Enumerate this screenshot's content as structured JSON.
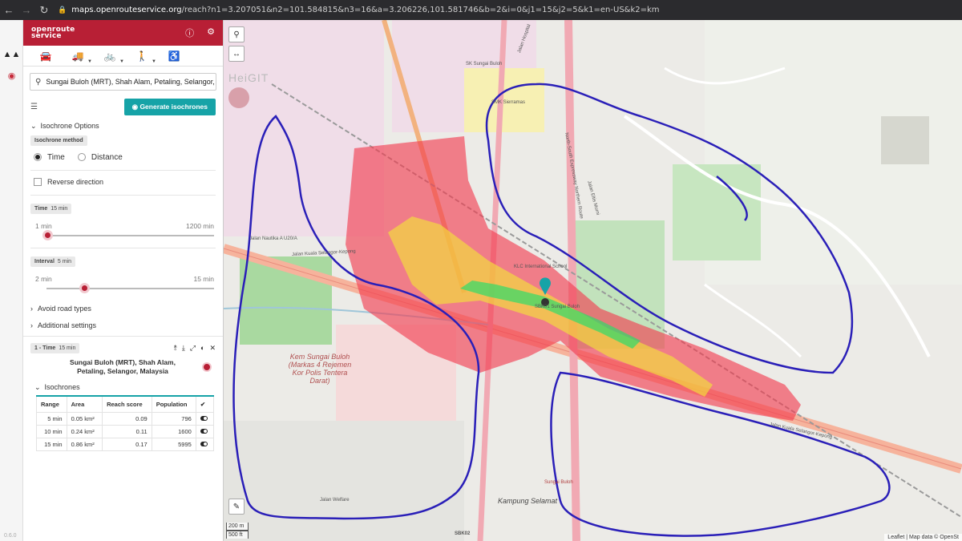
{
  "browser": {
    "url_host": "maps.openrouteservice.org",
    "url_path": "/reach?n1=3.207051&n2=101.584815&n3=16&a=3.206226,101.581746&b=2&i=0&j1=15&j2=5&k1=en-US&k2=km"
  },
  "brand": {
    "line1": "openroute",
    "line2": "service"
  },
  "app_version": "0.6.0",
  "search": {
    "value": "Sungai Buloh (MRT), Shah Alam, Petaling, Selangor,"
  },
  "generate_button": "Generate isochrones",
  "isochrone_options": {
    "title": "Isochrone Options",
    "method_label": "Isochrone method",
    "method_options": [
      "Time",
      "Distance"
    ],
    "reverse_direction": "Reverse direction",
    "time": {
      "label": "Time",
      "value_text": "15 min",
      "min_label": "1 min",
      "max_label": "1200 min",
      "value": 15,
      "min": 1,
      "max": 1200
    },
    "interval": {
      "label": "Interval",
      "value_text": "5 min",
      "min_label": "2 min",
      "max_label": "15 min",
      "value": 5,
      "min": 2,
      "max": 15
    }
  },
  "collapsibles": [
    "Avoid road types",
    "Additional settings"
  ],
  "result": {
    "chip_label": "1 - Time",
    "chip_value": "15 min",
    "origin": "Sungai Buloh (MRT), Shah Alam, Petaling, Selangor, Malaysia",
    "isochrones_title": "Isochrones",
    "columns": [
      "Range",
      "Area",
      "Reach score",
      "Population"
    ],
    "rows": [
      {
        "range": "5 min",
        "area": "0.05 km²",
        "reach": "0.09",
        "population": "796"
      },
      {
        "range": "10 min",
        "area": "0.24 km²",
        "reach": "0.11",
        "population": "1600"
      },
      {
        "range": "15 min",
        "area": "0.86 km²",
        "reach": "0.17",
        "population": "5995"
      }
    ]
  },
  "map": {
    "watermark": "HeiGIT",
    "scale_metric": "200 m",
    "scale_imperial": "500 ft",
    "attribution": "Leaflet | Map data © OpenSt",
    "labels": {
      "l1": "Jalan Kuala Selangor-Kepong",
      "l2": "Kem Sungai Buloh (Markas 4 Rejemen Kor Polis Tentera Darat)",
      "l3": "Kampung Selamat",
      "l4": "SK Sungai Buloh",
      "l5": "SMK Sierramas",
      "l6": "KLC International School",
      "l7": "SBK01 Sungai Buloh",
      "l8": "North-South Expressway Northern Route",
      "l9": "Jalan Welfare",
      "l10": "Sungai Buloh",
      "l11": "Jalan Nautika A U20/A",
      "l12": "Jalan Hospital",
      "l13": "Jalan Eltis Murni",
      "l14": "SBK02"
    },
    "colors": {
      "iso15": "#f23a4e",
      "iso10": "#f2e23a",
      "iso5": "#2fdc6a",
      "hand_drawn": "#2a1fb8",
      "brand": "#b81f35",
      "accent": "#16a3a7"
    }
  }
}
